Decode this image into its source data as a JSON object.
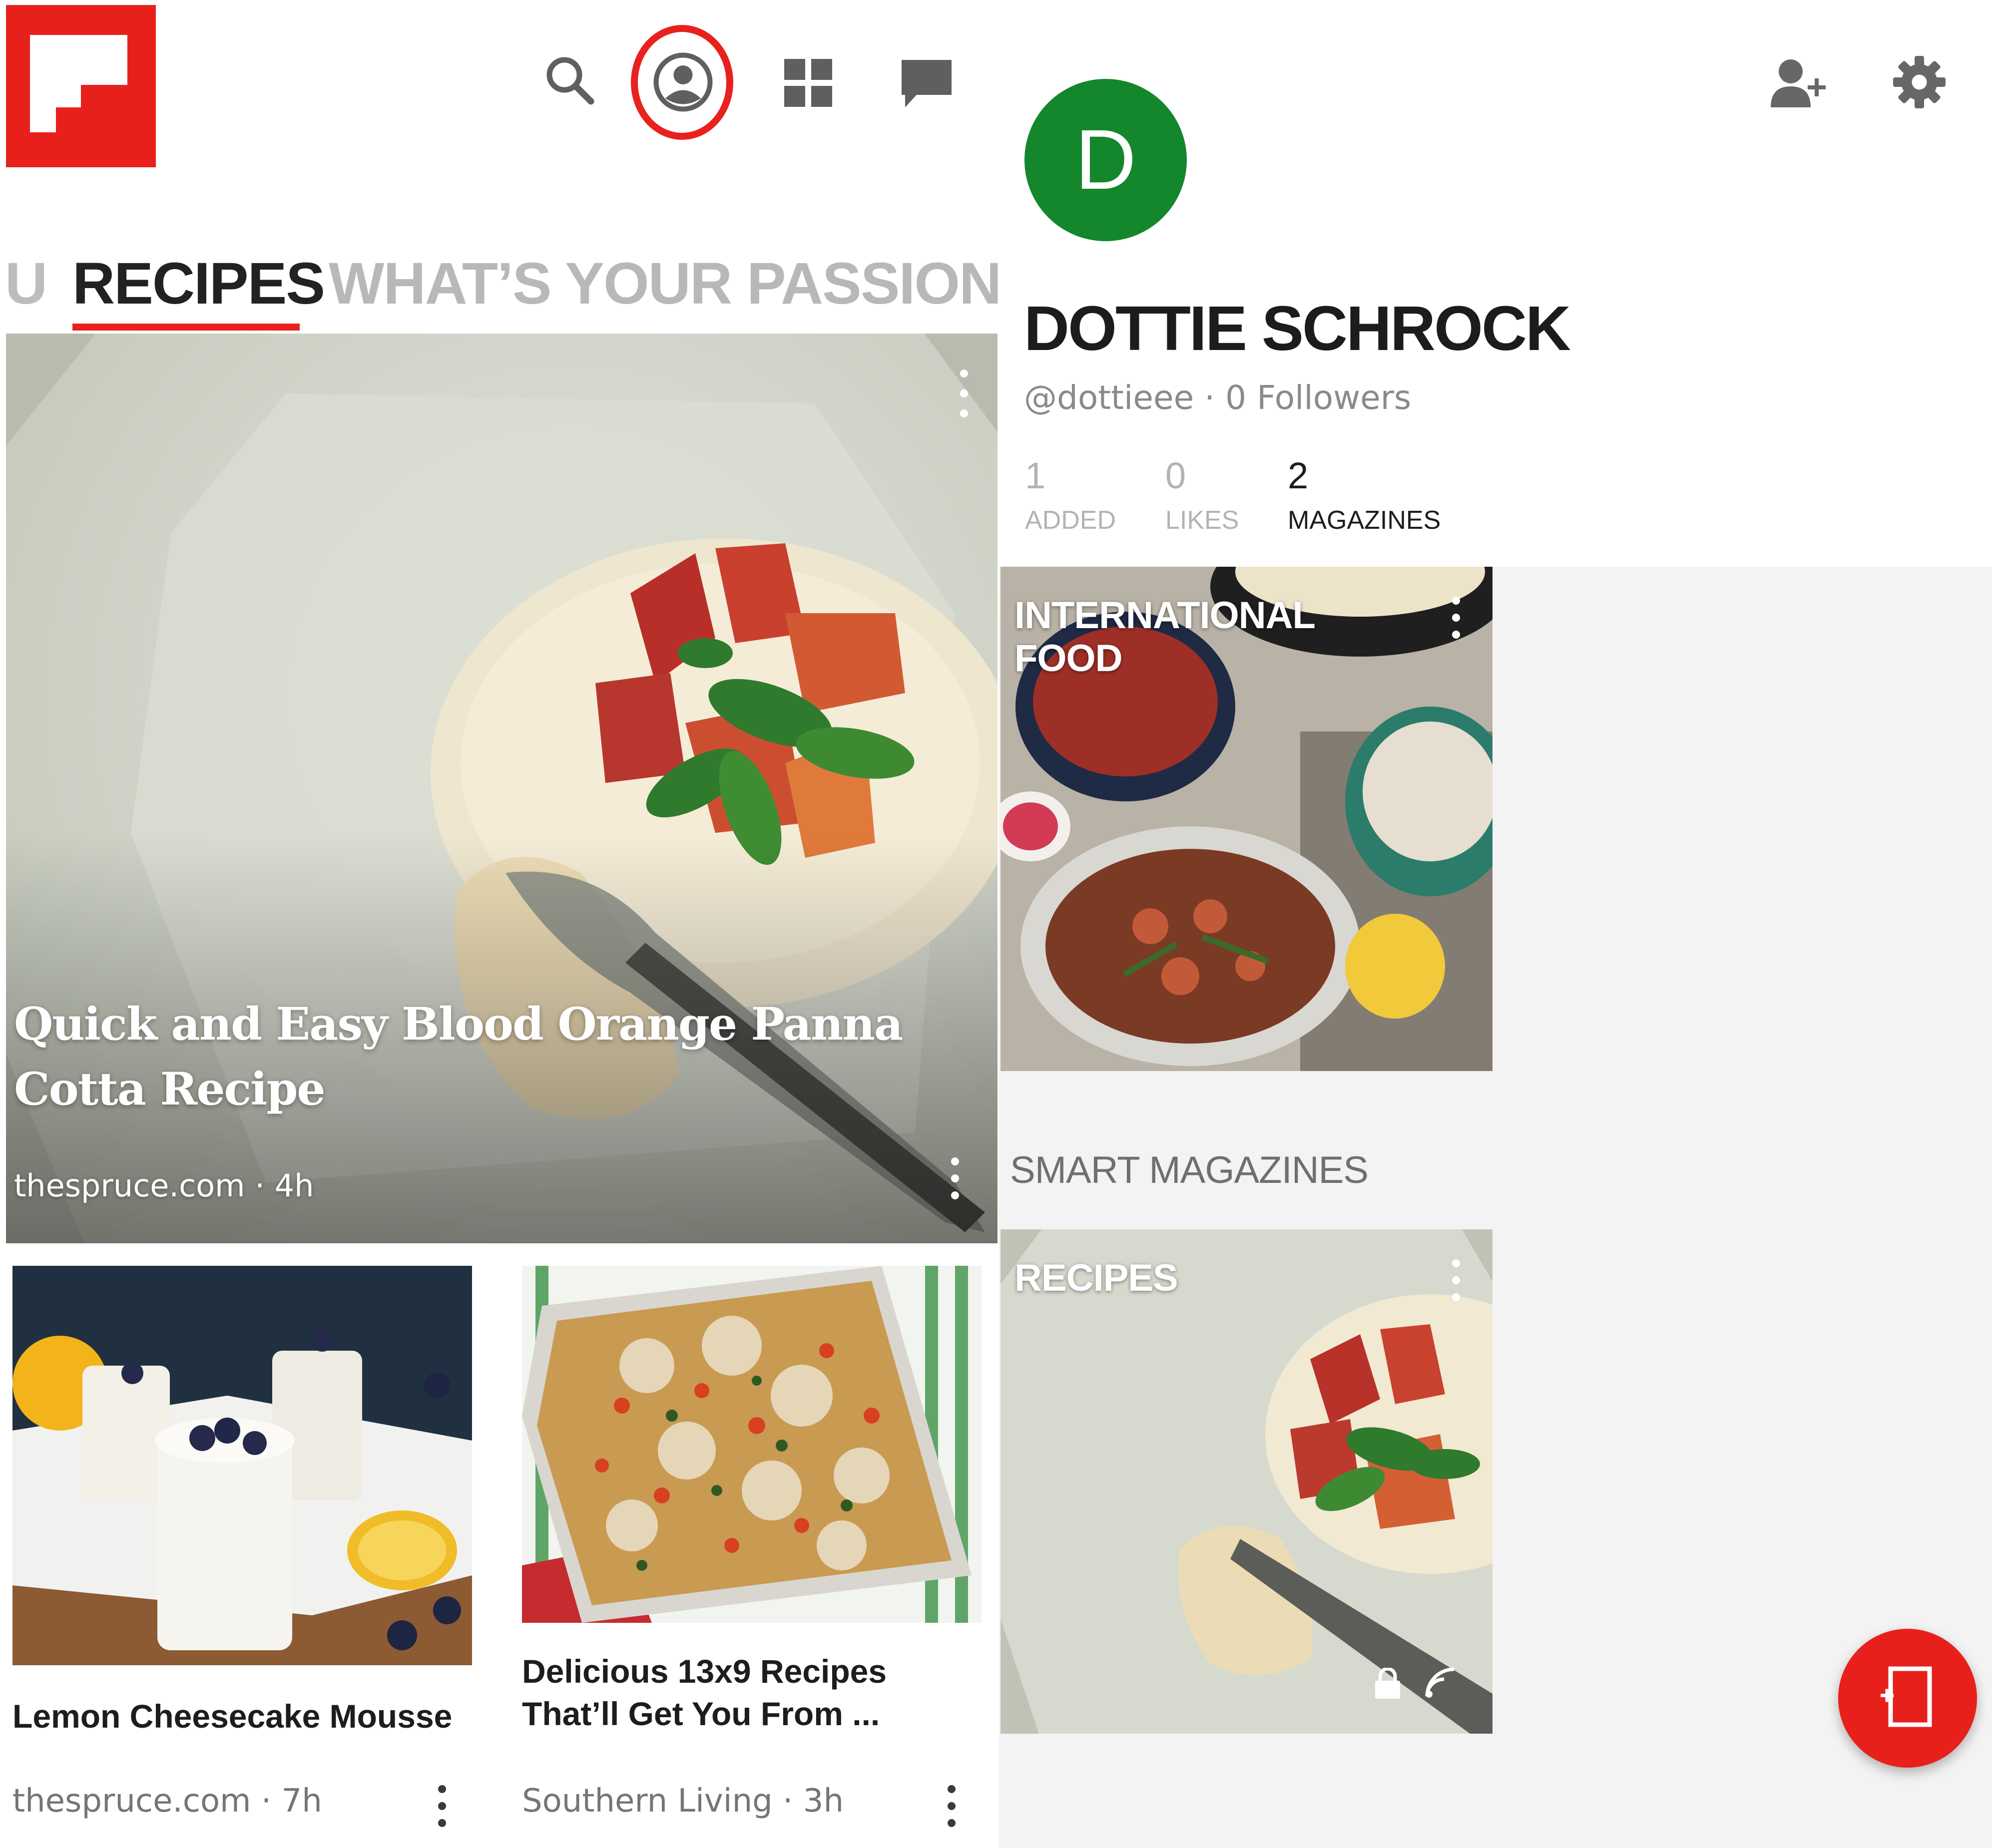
{
  "feed": {
    "tabs": {
      "previous": "U",
      "active": "RECIPES",
      "next": "WHAT’S YOUR PASSION?"
    },
    "toolbar_icons": [
      "search-icon",
      "profile-icon",
      "grid-icon",
      "chat-icon"
    ],
    "hero": {
      "title": "Quick and Easy Blood Orange Panna Cotta Recipe",
      "meta": "thespruce.com · 4h"
    },
    "cards": [
      {
        "title": "Lemon Cheesecake Mousse",
        "meta": "thespruce.com · 7h"
      },
      {
        "title": "Delicious 13x9 Recipes That’ll Get You From ...",
        "meta": "Southern Living · 3h"
      }
    ]
  },
  "profile": {
    "avatar_letter": "D",
    "name": "DOTTIE SCHROCK",
    "handle": "@dottieee · 0 Followers",
    "stats": [
      {
        "value": "1",
        "label": "ADDED"
      },
      {
        "value": "0",
        "label": "LIKES"
      },
      {
        "value": "2",
        "label": "MAGAZINES"
      }
    ],
    "magazines": [
      {
        "title": "INTERNATIONAL FOOD"
      }
    ],
    "smart_section_label": "SMART MAGAZINES",
    "smart_magazines": [
      {
        "title": "RECIPES"
      }
    ]
  },
  "colors": {
    "brand_red": "#e8201c",
    "avatar_green": "#14862c",
    "text_dark": "#1d1d1d",
    "text_muted": "#8a8a8a",
    "tab_inactive": "#b8b8b8"
  }
}
